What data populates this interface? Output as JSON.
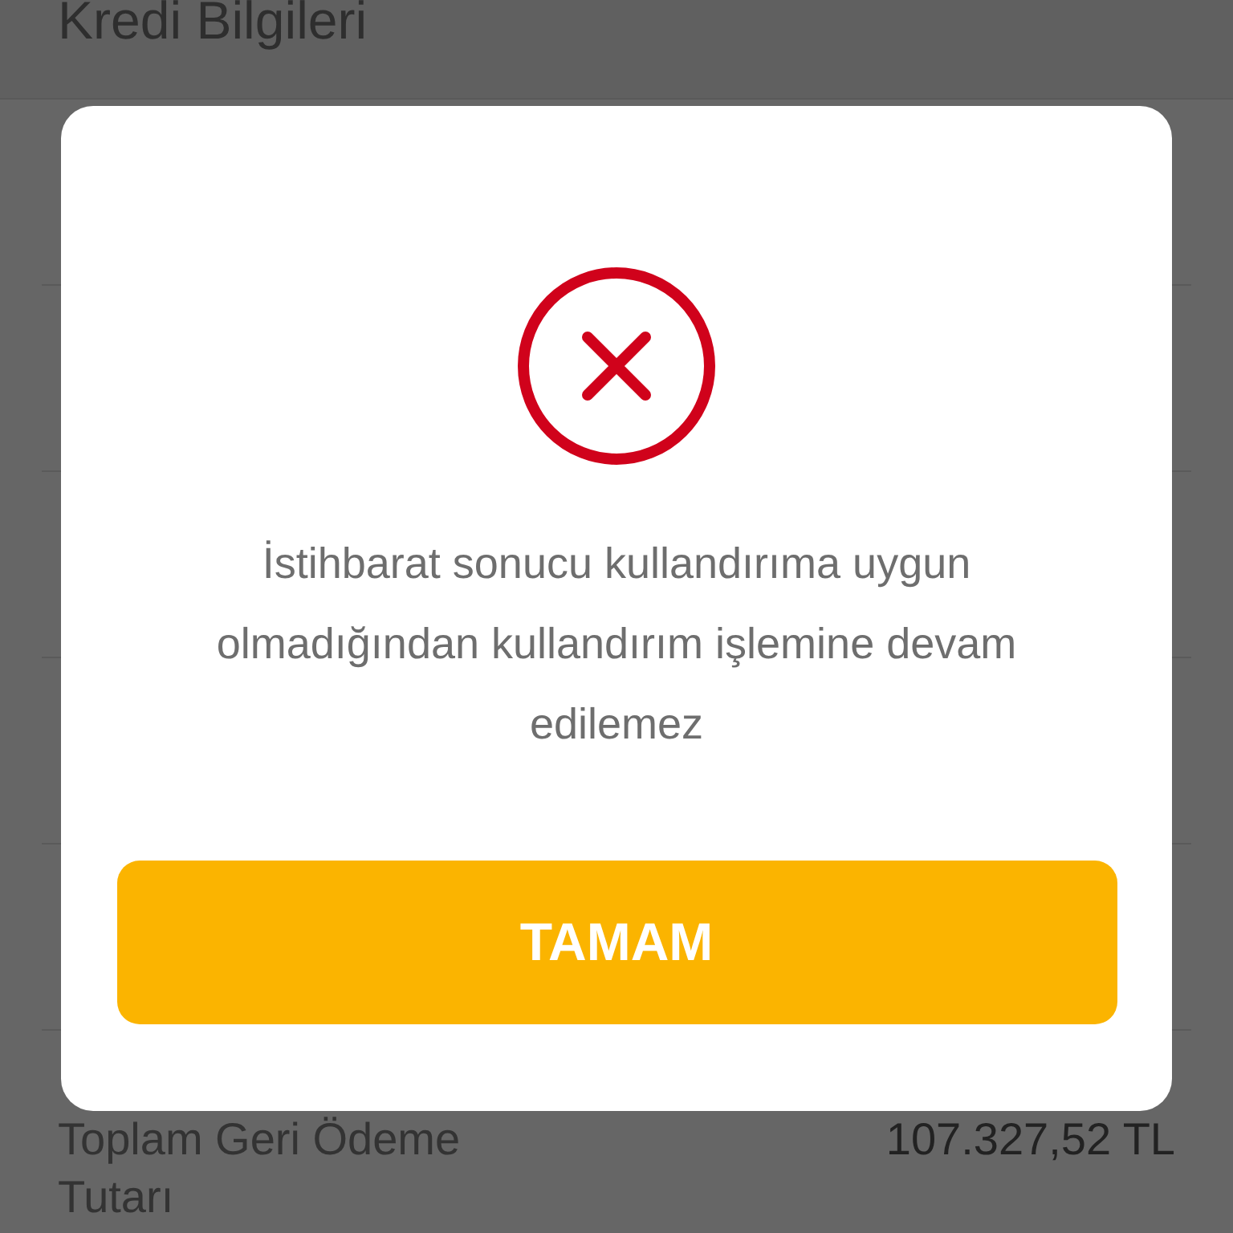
{
  "page": {
    "title": "Kredi Bilgileri",
    "rows": [
      {
        "label": "Toplam Geri Ödeme Tutarı",
        "value": "107.327,52 TL"
      }
    ]
  },
  "dialog": {
    "kind": "error",
    "message": "İstihbarat sonucu kullandırıma uygun olmadığından kullandırım işlemine devam edilemez",
    "button": "TAMAM"
  }
}
